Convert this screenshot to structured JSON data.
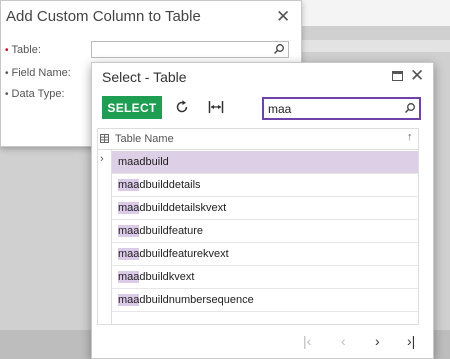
{
  "add_dialog": {
    "title": "Add Custom Column to Table",
    "close": "✕",
    "fields": [
      {
        "label": "Table:",
        "required_mark": "•"
      },
      {
        "label": "Field Name:",
        "required_mark": "•"
      },
      {
        "label": "Data Type:",
        "required_mark": "•"
      }
    ],
    "table_value": ""
  },
  "select_dialog": {
    "title": "Select - Table",
    "close": "✕",
    "select_label": "SELECT",
    "search_value": "maa",
    "column_header": "Table Name",
    "sort_indicator": "↑",
    "row_indicator": "›",
    "highlight_prefix": "maa",
    "rows": [
      {
        "prefix": "maa",
        "rest": "dbuild",
        "selected": true
      },
      {
        "prefix": "maa",
        "rest": "dbuilddetails",
        "selected": false
      },
      {
        "prefix": "maa",
        "rest": "dbuilddetailskvext",
        "selected": false
      },
      {
        "prefix": "maa",
        "rest": "dbuildfeature",
        "selected": false
      },
      {
        "prefix": "maa",
        "rest": "dbuildfeaturekvext",
        "selected": false
      },
      {
        "prefix": "maa",
        "rest": "dbuildkvext",
        "selected": false
      },
      {
        "prefix": "maa",
        "rest": "dbuildnumbersequence",
        "selected": false
      }
    ],
    "pager": {
      "first": "|‹",
      "prev": "‹",
      "next": "›",
      "last": "›|"
    }
  },
  "colors": {
    "select_button": "#1e9e52",
    "search_border": "#6f42a5",
    "selected_row": "#ddcfe6",
    "required_mark": "#cc0000"
  },
  "icons": [
    "search-icon",
    "close-icon",
    "maximize-icon",
    "refresh-icon",
    "fit-columns-icon",
    "column-settings-icon"
  ]
}
